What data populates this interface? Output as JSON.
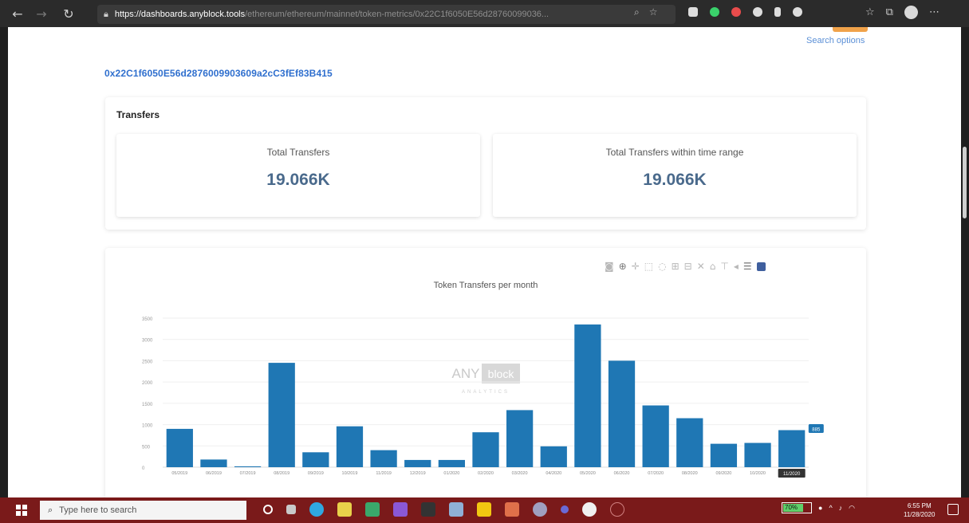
{
  "browser": {
    "url_host": "https://dashboards.anyblock.tools",
    "url_path": "/ethereum/ethereum/mainnet/token-metrics/0x22C1f6050E56d28760099036...",
    "back_icon": "arrow-left-icon",
    "forward_icon": "arrow-right-icon",
    "refresh_icon": "refresh-icon",
    "lock_icon": "lock-icon"
  },
  "page": {
    "search_options_label": "Search options",
    "token_address": "0x22C1f6050E56d2876009903609a2cC3fEf83B415"
  },
  "transfers": {
    "title": "Transfers",
    "total_label": "Total Transfers",
    "total_value": "19.066K",
    "range_label": "Total Transfers within time range",
    "range_value": "19.066K"
  },
  "chart_data": {
    "type": "bar",
    "title": "Token Transfers per month",
    "categories": [
      "05/2019",
      "06/2019",
      "07/2019",
      "08/2019",
      "09/2019",
      "10/2019",
      "11/2019",
      "12/2019",
      "01/2020",
      "02/2020",
      "03/2020",
      "04/2020",
      "05/2020",
      "06/2020",
      "07/2020",
      "08/2020",
      "09/2020",
      "10/2020",
      "11/2020"
    ],
    "values": [
      900,
      180,
      20,
      2450,
      350,
      960,
      400,
      170,
      170,
      820,
      1340,
      490,
      3350,
      2500,
      1450,
      1150,
      550,
      570,
      870
    ],
    "ylim": [
      0,
      3500
    ],
    "yticks": [
      0,
      500,
      1000,
      1500,
      2000,
      2500,
      3000,
      3500
    ],
    "ytick_labels": [
      "0",
      "500",
      "1000",
      "1500",
      "2000",
      "2500",
      "3000",
      "3500"
    ],
    "grid": true,
    "bar_color": "#1f77b4",
    "hover_category": "11/2020",
    "hover_value_label": "885",
    "watermark_main": "ANY",
    "watermark_box": "block",
    "watermark_sub": "ANALYTICS"
  },
  "taskbar": {
    "search_placeholder": "Type here to search",
    "battery_label": "70%",
    "time": "6:55 PM",
    "date": "11/28/2020"
  },
  "colors": {
    "accent_link": "#2f6fce",
    "stat_value": "#4a6a8c",
    "taskbar": "#7a1a1a"
  }
}
